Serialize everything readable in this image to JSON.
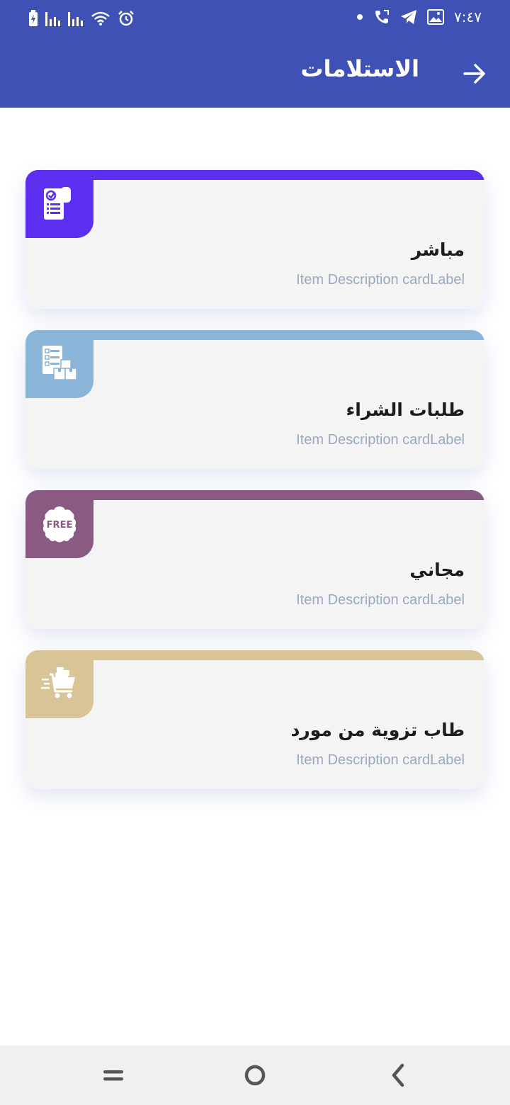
{
  "status_bar": {
    "time": "٧:٤٧",
    "left_icons": [
      "battery-charging-icon",
      "signal-icon",
      "signal-icon",
      "wifi-icon",
      "alarm-icon"
    ],
    "right_icons": [
      "dot-icon",
      "phone-call-icon",
      "telegram-icon",
      "gallery-icon"
    ]
  },
  "app_bar": {
    "title": "الاستلامات",
    "background": "#3f51b5",
    "back_icon": "arrow-right-icon"
  },
  "cards": [
    {
      "title": "مباشر",
      "description": "Item Description cardLabel",
      "accent": "#5b2ef0",
      "icon": "document-check-icon"
    },
    {
      "title": "طلبات الشراء",
      "description": "Item Description cardLabel",
      "accent": "#8ab4d8",
      "icon": "checklist-boxes-icon"
    },
    {
      "title": "مجاني",
      "description": "Item Description cardLabel",
      "accent": "#8a5a82",
      "icon": "free-badge-icon",
      "icon_text": "FREE"
    },
    {
      "title": "طاب تزوية من مورد",
      "description": "Item Description cardLabel",
      "accent": "#d8c496",
      "icon": "shopping-cart-icon"
    }
  ],
  "nav_bar": {
    "buttons": [
      "recents-icon",
      "home-icon",
      "back-icon"
    ]
  }
}
